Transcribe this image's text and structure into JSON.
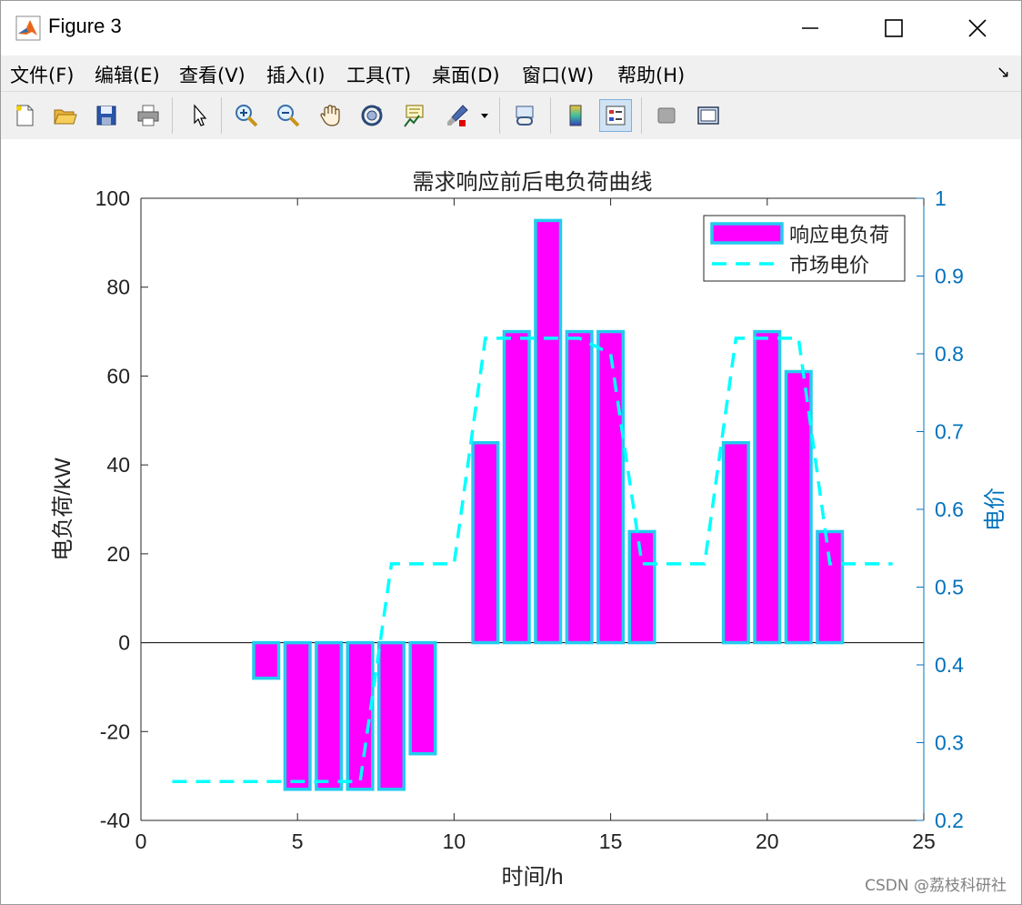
{
  "window": {
    "title": "Figure 3",
    "menu": [
      "文件(F)",
      "编辑(E)",
      "查看(V)",
      "插入(I)",
      "工具(T)",
      "桌面(D)",
      "窗口(W)",
      "帮助(H)"
    ],
    "menu_arrow": "↘"
  },
  "toolbar": {
    "icons": [
      "new-file-icon",
      "open-folder-icon",
      "save-icon",
      "print-icon",
      "pointer-icon",
      "zoom-in-icon",
      "zoom-out-icon",
      "pan-hand-icon",
      "rotate-3d-icon",
      "data-cursor-icon",
      "brush-icon",
      "link-plot-icon",
      "colorbar-icon",
      "legend-icon",
      "hide-plot-tools-icon",
      "show-plot-tools-icon"
    ]
  },
  "chart_data": {
    "type": "bar",
    "title": "需求响应前后电负荷曲线",
    "xlabel": "时间/h",
    "ylabel": "电负荷/kW",
    "ylabel_right": "电价",
    "xlim": [
      0,
      25
    ],
    "ylim": [
      -40,
      100
    ],
    "ylim_right": [
      0.2,
      1
    ],
    "xticks": [
      0,
      5,
      10,
      15,
      20,
      25
    ],
    "yticks": [
      -40,
      -20,
      0,
      20,
      40,
      60,
      80,
      100
    ],
    "yticks_right": [
      0.2,
      0.3,
      0.4,
      0.5,
      0.6,
      0.7,
      0.8,
      0.9,
      1
    ],
    "grid": false,
    "legend_position": "top-right",
    "bar_fill_color": "#ff00ff",
    "bar_edge_color": "#22ccee",
    "line_color": "#00ffff",
    "right_axis_color": "#0072bd",
    "series": [
      {
        "name": "响应电负荷",
        "type": "bar",
        "x": [
          1,
          2,
          3,
          4,
          5,
          6,
          7,
          8,
          9,
          10,
          11,
          12,
          13,
          14,
          15,
          16,
          17,
          18,
          19,
          20,
          21,
          22,
          23,
          24
        ],
        "values": [
          0,
          0,
          0,
          -8,
          -33,
          -33,
          -33,
          -33,
          -25,
          0,
          45,
          70,
          95,
          70,
          70,
          25,
          0,
          0,
          45,
          70,
          61,
          25,
          0,
          0
        ]
      },
      {
        "name": "市场电价",
        "type": "line",
        "style": "dashed",
        "x": [
          1,
          2,
          3,
          4,
          5,
          6,
          7,
          8,
          9,
          10,
          11,
          12,
          13,
          14,
          15,
          16,
          17,
          18,
          19,
          20,
          21,
          22,
          23,
          24
        ],
        "values": [
          0.25,
          0.25,
          0.25,
          0.25,
          0.25,
          0.25,
          0.25,
          0.53,
          0.53,
          0.53,
          0.82,
          0.82,
          0.82,
          0.82,
          0.8,
          0.53,
          0.53,
          0.53,
          0.82,
          0.82,
          0.82,
          0.53,
          0.53,
          0.53
        ]
      }
    ]
  },
  "watermark": "CSDN @荔枝科研社"
}
